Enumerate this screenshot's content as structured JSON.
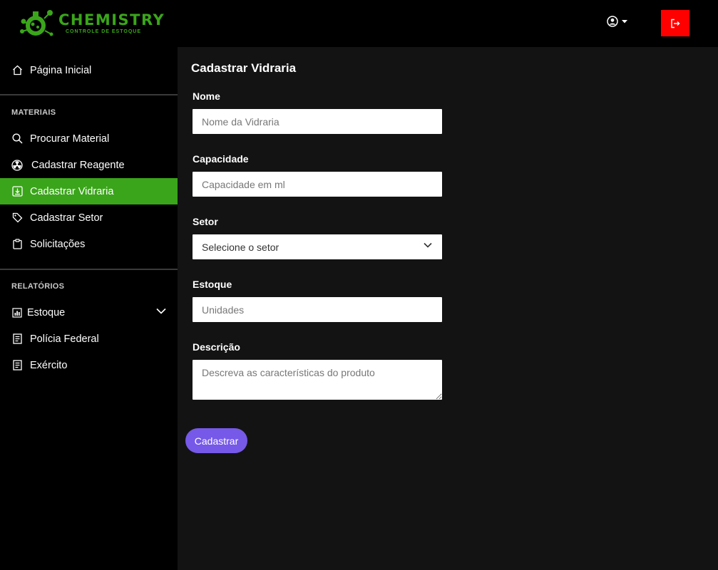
{
  "brand": {
    "title": "CHEMISTRY",
    "subtitle": "CONTROLE DE ESTOQUE",
    "color": "#3aa51a"
  },
  "header": {
    "user_icon": "user-circle-icon",
    "logout_icon": "logout-icon",
    "logout_color": "#ff0000"
  },
  "sidebar": {
    "home": {
      "label": "Página Inicial",
      "icon": "home-icon"
    },
    "sections": [
      {
        "title": "MATERIAIS",
        "items": [
          {
            "label": "Procurar Material",
            "icon": "search-icon"
          },
          {
            "label": "Cadastrar Reagente",
            "icon": "radiation-icon"
          },
          {
            "label": "Cadastrar Vidraria",
            "icon": "download-box-icon",
            "active": true
          },
          {
            "label": "Cadastrar Setor",
            "icon": "tag-icon"
          },
          {
            "label": "Solicitações",
            "icon": "clipboard-icon"
          }
        ]
      },
      {
        "title": "RELATÓRIOS",
        "items": [
          {
            "label": "Estoque",
            "icon": "bar-chart-icon",
            "expandable": true
          },
          {
            "label": "Polícia Federal",
            "icon": "document-icon"
          },
          {
            "label": "Exército",
            "icon": "document-icon"
          }
        ]
      }
    ]
  },
  "form": {
    "title": "Cadastrar Vidraria",
    "fields": {
      "nome": {
        "label": "Nome",
        "placeholder": "Nome da Vidraria"
      },
      "capacidade": {
        "label": "Capacidade",
        "placeholder": "Capacidade em ml"
      },
      "setor": {
        "label": "Setor",
        "selected": "Selecione o setor"
      },
      "estoque": {
        "label": "Estoque",
        "placeholder": "Unidades"
      },
      "descricao": {
        "label": "Descrição",
        "placeholder": "Descreva as características do produto"
      }
    },
    "submit_label": "Cadastrar",
    "submit_color": "#7659e8"
  },
  "accent_active": "#3aa51a"
}
